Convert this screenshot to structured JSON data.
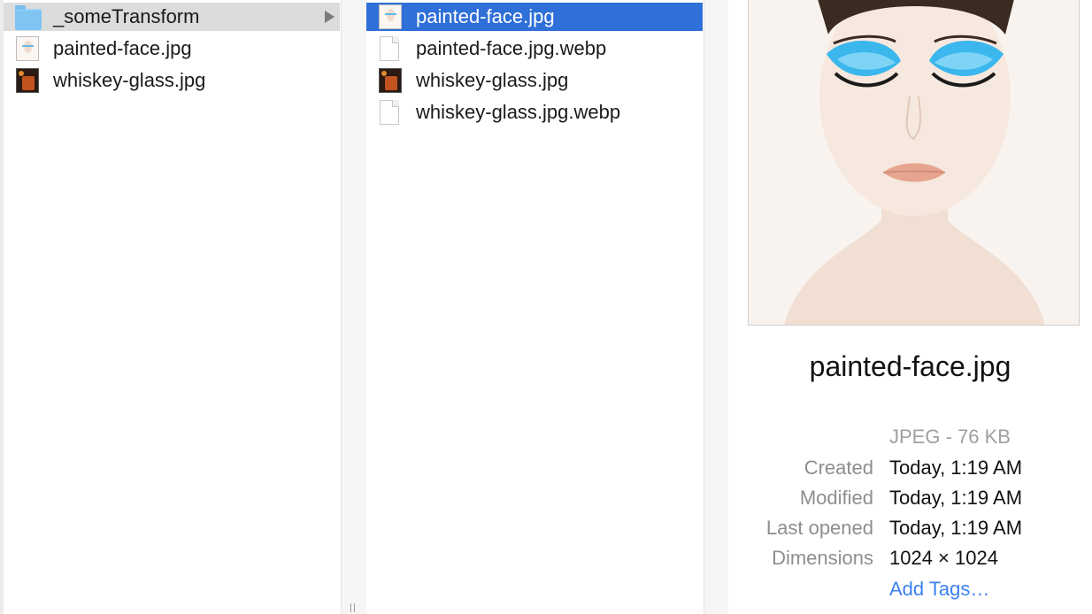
{
  "column1": {
    "items": [
      {
        "label": "_someTransform",
        "icon": "folder-icon"
      },
      {
        "label": "painted-face.jpg",
        "icon": "image-thumbnail-face"
      },
      {
        "label": "whiskey-glass.jpg",
        "icon": "image-thumbnail-whiskey"
      }
    ]
  },
  "column2": {
    "items": [
      {
        "label": "painted-face.jpg",
        "icon": "image-thumbnail-face"
      },
      {
        "label": "painted-face.jpg.webp",
        "icon": "document-icon"
      },
      {
        "label": "whiskey-glass.jpg",
        "icon": "image-thumbnail-whiskey"
      },
      {
        "label": "whiskey-glass.jpg.webp",
        "icon": "document-icon"
      }
    ]
  },
  "preview": {
    "filename": "painted-face.jpg",
    "kind_size": "JPEG - 76 KB",
    "created_label": "Created",
    "created_value": "Today, 1:19 AM",
    "modified_label": "Modified",
    "modified_value": "Today, 1:19 AM",
    "last_opened_label": "Last opened",
    "last_opened_value": "Today, 1:19 AM",
    "dimensions_label": "Dimensions",
    "dimensions_value": "1024 × 1024",
    "add_tags": "Add Tags…"
  },
  "colors": {
    "selection": "#2f6fd8",
    "highlight": "#dcdcdc",
    "link": "#3b82f0"
  }
}
